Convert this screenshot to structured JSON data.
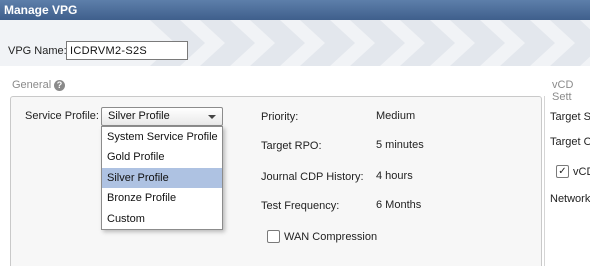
{
  "window": {
    "title": "Manage VPG"
  },
  "vpg": {
    "name_label": "VPG Name:",
    "name_value": "ICDRVM2-S2S"
  },
  "general": {
    "section_label": "General",
    "help_icon": "question-circle-icon",
    "service_profile_label": "Service Profile:",
    "service_profile_value": "Silver Profile",
    "dropdown_options": [
      "System Service Profile",
      "Gold Profile",
      "Silver Profile",
      "Bronze Profile",
      "Custom"
    ],
    "selected_option": "Silver Profile",
    "priority_label": "Priority:",
    "priority_value": "Medium",
    "target_rpo_label": "Target RPO:",
    "target_rpo_value": "5 minutes",
    "journal_label": "Journal CDP History:",
    "journal_value": "4 hours",
    "test_frequency_label": "Test Frequency:",
    "test_frequency_value": "6 Months",
    "wan_compression_label": "WAN Compression",
    "wan_compression_checked": false
  },
  "vcd": {
    "section_label": "vCD Sett",
    "target_si_label": "Target Si",
    "target_or_label": "Target Or",
    "vcd_checkbox_label": "vCD",
    "vcd_checked": true,
    "network_label": "Network"
  },
  "colors": {
    "titlebar": "#4a6b98",
    "selected_option": "#aec2e2",
    "panel_background": "#f7f7f7"
  }
}
